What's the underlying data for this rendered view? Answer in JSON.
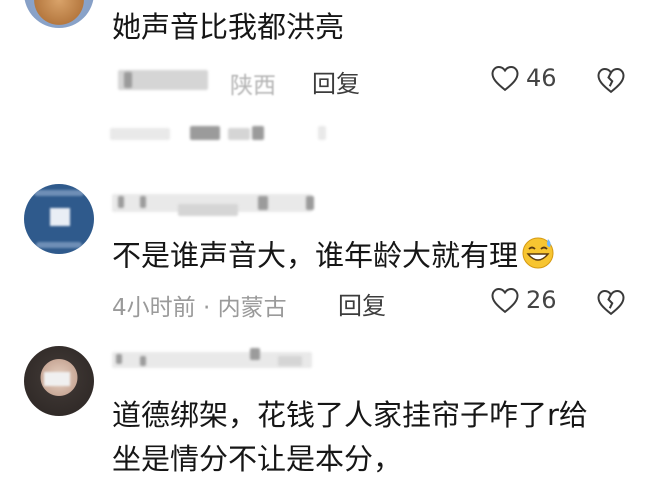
{
  "comments": [
    {
      "text": "她声音比我都洪亮",
      "location": "陕西",
      "reply_label": "回复",
      "likes": "46"
    },
    {
      "text": "不是谁声音大，谁年龄大就有理",
      "time": "4小时前 · 内蒙古",
      "reply_label": "回复",
      "likes": "26",
      "emoji": "grinning-sweat-emoji"
    },
    {
      "text_line1": "道德绑架，花钱了人家挂帘子咋了r给",
      "text_line2": "坐是情分不让是本分，"
    }
  ],
  "icons": {
    "like": "heart-outline-icon",
    "dislike": "broken-heart-icon"
  },
  "colors": {
    "text": "#161616",
    "meta": "#9a9a9a",
    "reply": "#3c3c3c"
  }
}
